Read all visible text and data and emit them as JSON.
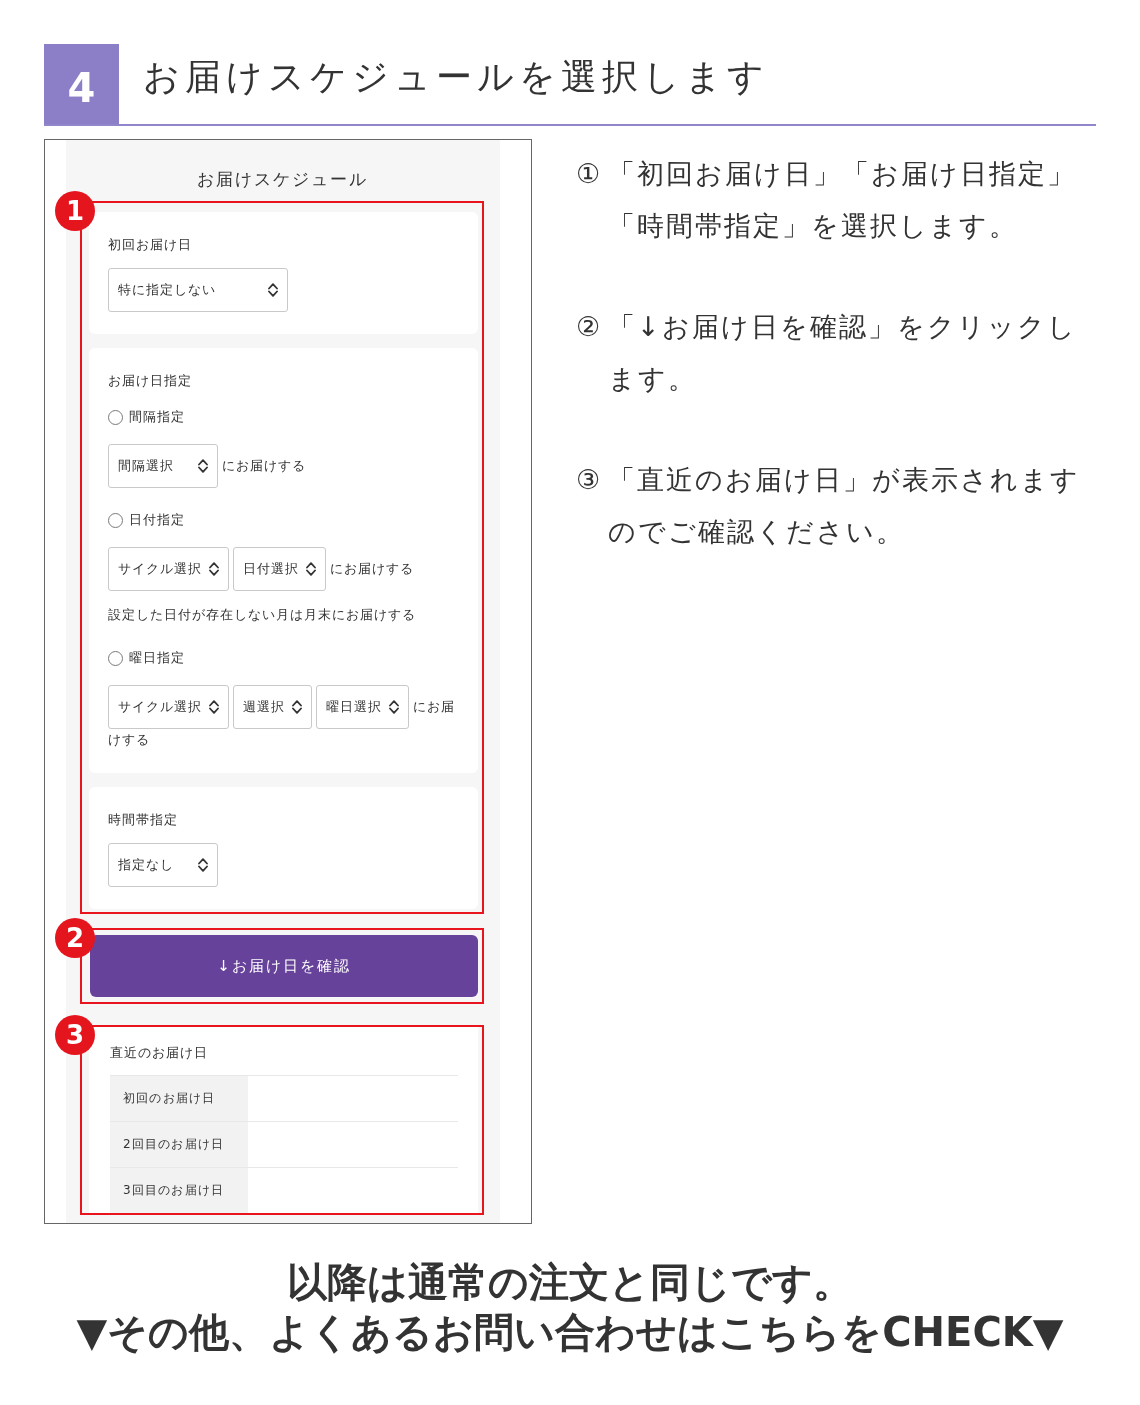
{
  "header": {
    "step": "4",
    "title": "お届けスケジュールを選択します"
  },
  "screenshot": {
    "title": "お届けスケジュール",
    "sections": [
      {
        "kind": "form",
        "badge": "1",
        "cards": [
          {
            "kind": "dropdown",
            "label": "初回お届け日",
            "dropdown": "特に指定しない"
          },
          {
            "kind": "radio_group",
            "label": "お届け日指定",
            "options": [
              {
                "label": "間隔指定",
                "selected": false,
                "dropdowns": [
                  "間隔選択"
                ],
                "suffix": "にお届けする"
              },
              {
                "label": "日付指定",
                "selected": false,
                "dropdowns": [
                  "サイクル選択",
                  "日付選択"
                ],
                "suffix": "にお届けする",
                "note": "設定した日付が存在しない月は月末にお届けする"
              },
              {
                "label": "曜日指定",
                "selected": false,
                "dropdowns": [
                  "サイクル選択",
                  "週選択",
                  "曜日選択"
                ],
                "suffix": "にお届",
                "suffix_continued": "けする"
              }
            ]
          },
          {
            "kind": "dropdown",
            "label": "時間帯指定",
            "dropdown": "指定なし"
          }
        ]
      },
      {
        "kind": "button",
        "badge": "2",
        "button": "↓お届け日を確認"
      },
      {
        "kind": "table",
        "badge": "3",
        "title": "直近のお届け日",
        "rows": [
          {
            "label": "初回のお届け日"
          },
          {
            "label": "2回目のお届け日"
          },
          {
            "label": "3回目のお届け日"
          }
        ]
      }
    ]
  },
  "steps": [
    {
      "marker": "①",
      "text": "「初回お届け日」「お届け日指定」「時間帯指定」を選択します。"
    },
    {
      "marker": "②",
      "text": "「↓お届け日を確認」をクリックします。"
    },
    {
      "marker": "③",
      "text": "「直近のお届け日」が表示されますのでご確認ください。"
    }
  ],
  "footer": {
    "note": "以降は通常の注文と同じです。",
    "link": "▼その他、よくあるお問い合わせはこちらをCHECK▼"
  }
}
